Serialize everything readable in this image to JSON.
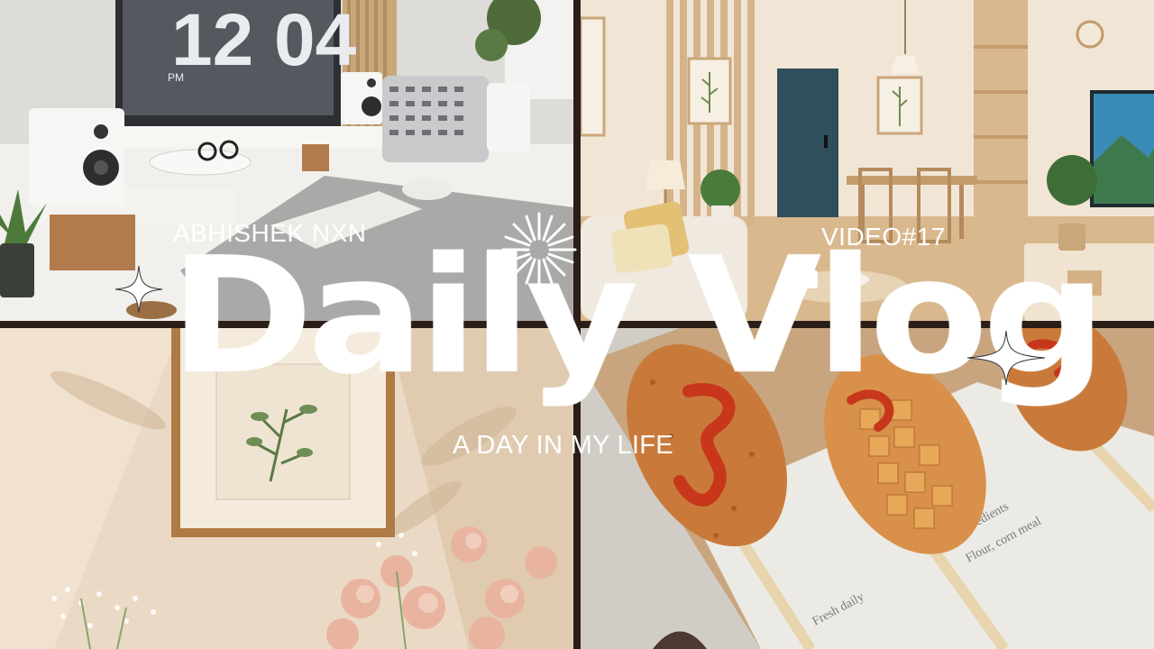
{
  "thumbnail": {
    "creator": "ABHISHEK NXN",
    "episode": "VIDEO#17",
    "title": "Daily Vlog",
    "subtitle": "A DAY IN MY LIFE",
    "clock_display": {
      "time": "12 04",
      "period": "PM"
    }
  },
  "colors": {
    "divider": "#3a2a22",
    "text": "#ffffff",
    "ketchup": "#c8371c",
    "batter": "#c97a3a",
    "frame_wood": "#b07a45",
    "door_teal": "#2f4f5a"
  },
  "icons": [
    "sparkle-icon",
    "starburst-icon"
  ]
}
